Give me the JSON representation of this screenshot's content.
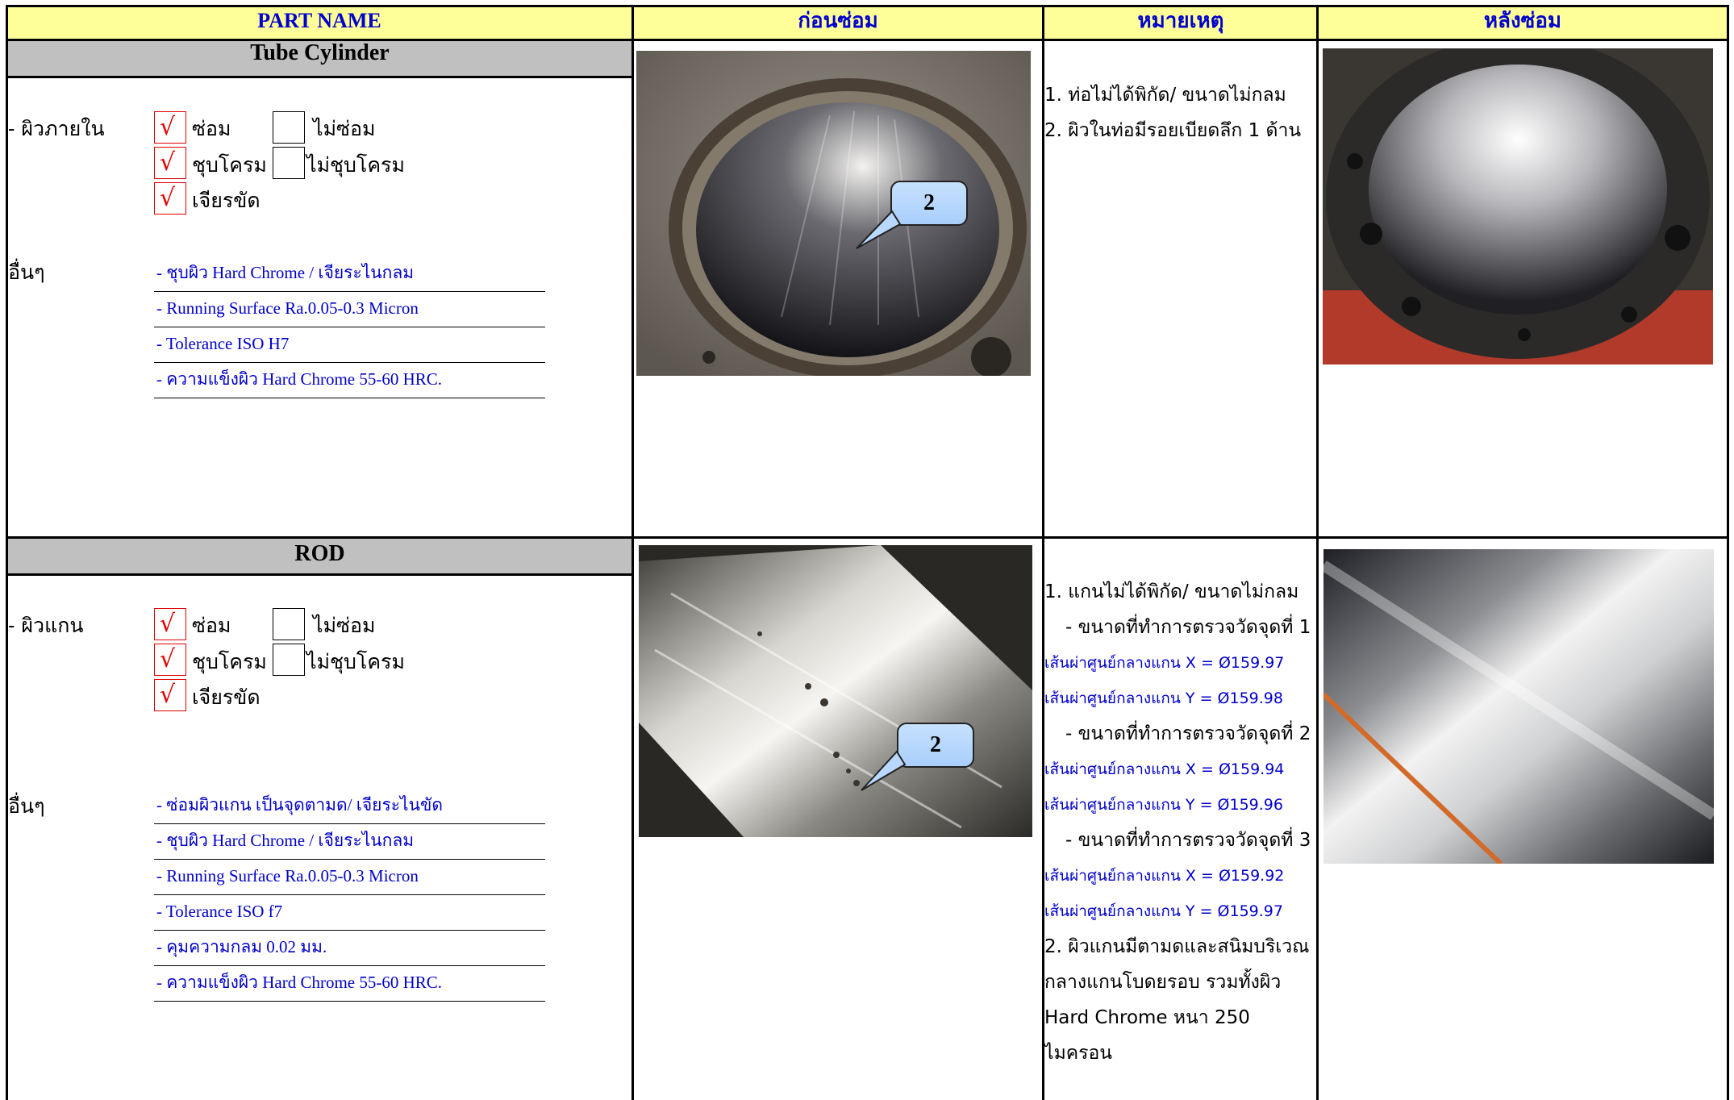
{
  "header": {
    "part_name": "PART NAME",
    "before": "ก่อนซ่อม",
    "remarks": "หมายเหตุ",
    "after": "หลังซ่อม"
  },
  "sections": [
    {
      "title": "Tube Cylinder",
      "surface_label": "- ผิวภายใน",
      "options": {
        "repair": "ซ่อม",
        "no_repair": "ไม่ซ่อม",
        "chrome": "ชุบโครม",
        "no_chrome": "ไม่ชุบโครม",
        "grind": "เจียรขัด"
      },
      "checked": {
        "repair": true,
        "no_repair": false,
        "chrome": true,
        "no_chrome": false,
        "grind": true
      },
      "other_label": "อื่นๆ",
      "specs": [
        "- ชุบผิว Hard Chrome / เจียระไนกลม",
        "- Running Surface Ra.0.05-0.3 Micron",
        "- Tolerance ISO H7",
        "- ความแข็งผิว Hard Chrome 55-60 HRC."
      ],
      "callout": "2",
      "notes": [
        "1. ท่อไม่ได้พิกัด/ ขนาดไม่กลม",
        "2. ผิวในท่อมีรอยเบียดลึก 1 ด้าน"
      ]
    },
    {
      "title": "ROD",
      "surface_label": "- ผิวแกน",
      "options": {
        "repair": "ซ่อม",
        "no_repair": "ไม่ซ่อม",
        "chrome": "ชุบโครม",
        "no_chrome": "ไม่ชุบโครม",
        "grind": "เจียรขัด"
      },
      "checked": {
        "repair": true,
        "no_repair": false,
        "chrome": true,
        "no_chrome": false,
        "grind": true
      },
      "other_label": "อื่นๆ",
      "specs": [
        "- ซ่อมผิวแกน เป็นจุดตามด/ เจียระไนขัด",
        "- ชุบผิว Hard Chrome / เจียระไนกลม",
        "- Running Surface Ra.0.05-0.3 Micron",
        "- Tolerance ISO f7",
        "- คุมความกลม 0.02 มม.",
        "- ความแข็งผิว Hard Chrome 55-60 HRC."
      ],
      "callout": "2",
      "notes": [
        {
          "text": "1. แกนไม่ได้พิกัด/ ขนาดไม่กลม",
          "style": "black"
        },
        {
          "text": "- ขนาดที่ทำการตรวจวัดจุดที่ 1",
          "style": "indent"
        },
        {
          "text": "เส้นผ่าศูนย์กลางแกน  X = Ø159.97",
          "style": "blue"
        },
        {
          "text": "เส้นผ่าศูนย์กลางแกน  Y = Ø159.98",
          "style": "blue"
        },
        {
          "text": "- ขนาดที่ทำการตรวจวัดจุดที่ 2",
          "style": "indent"
        },
        {
          "text": "เส้นผ่าศูนย์กลางแกน  X = Ø159.94",
          "style": "blue"
        },
        {
          "text": "เส้นผ่าศูนย์กลางแกน  Y = Ø159.96",
          "style": "blue"
        },
        {
          "text": "- ขนาดที่ทำการตรวจวัดจุดที่ 3",
          "style": "indent"
        },
        {
          "text": "เส้นผ่าศูนย์กลางแกน  X = Ø159.92",
          "style": "blue"
        },
        {
          "text": "เส้นผ่าศูนย์กลางแกน  Y = Ø159.97",
          "style": "blue"
        },
        {
          "text": "2. ผิวแกนมีตามดและสนิมบริเวณ",
          "style": "black"
        },
        {
          "text": "กลางแกนโบดยรอบ รวมทั้งผิว",
          "style": "black"
        },
        {
          "text": "Hard Chrome หนา 250 ไมครอน",
          "style": "black"
        }
      ]
    }
  ],
  "colors": {
    "header_bg": "#ffff99",
    "header_text": "#0000cc",
    "section_bar": "#c0c0c0",
    "check": "#e00000",
    "spec_text": "#0000cc"
  }
}
